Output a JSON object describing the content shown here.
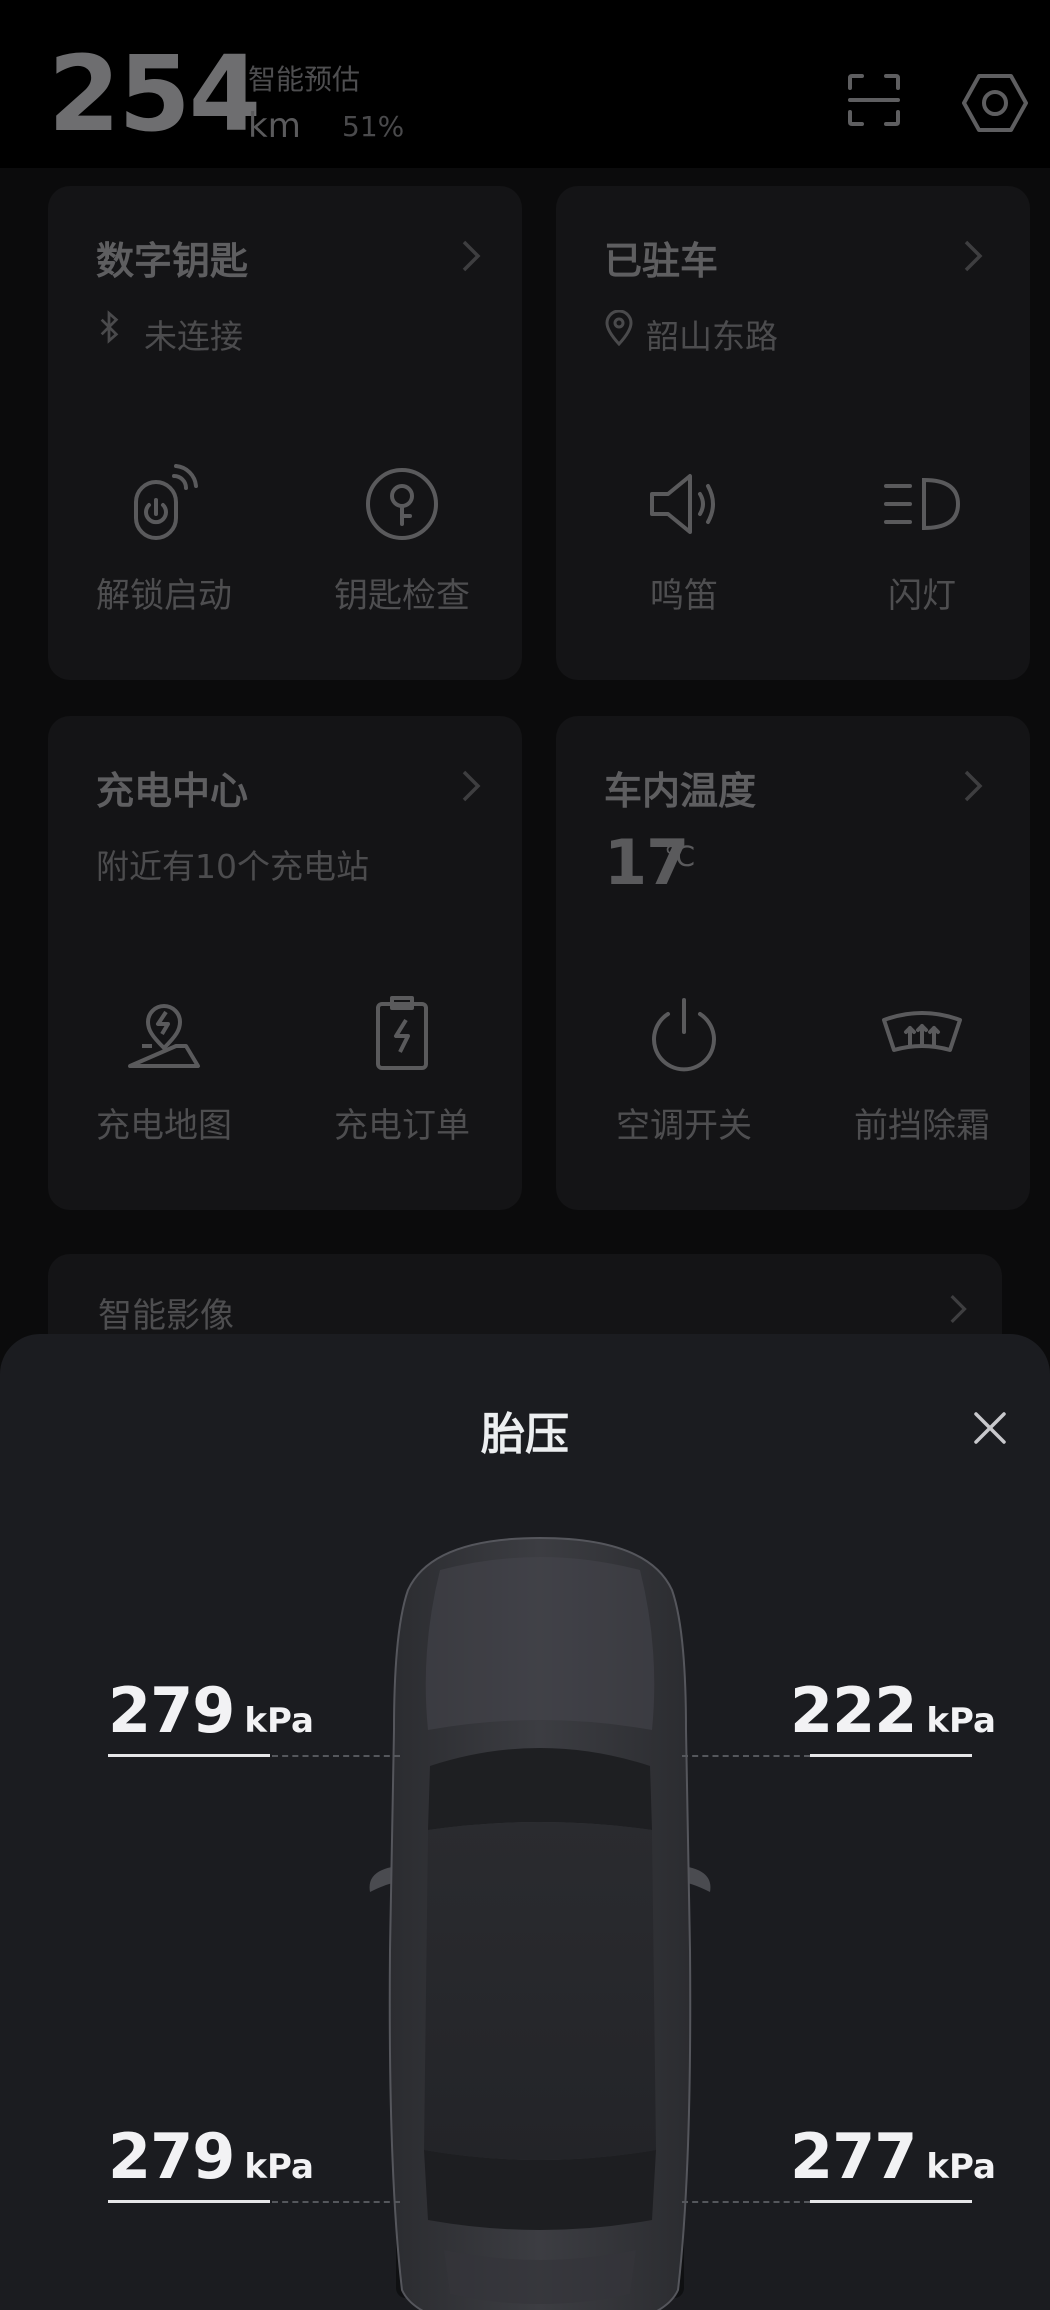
{
  "header": {
    "range_value": "254",
    "range_label": "智能预估",
    "range_unit": "km",
    "battery_percent": "51%",
    "icons": [
      "scan-icon",
      "gear-icon"
    ]
  },
  "cards": {
    "digital_key": {
      "title": "数字钥匙",
      "status": "未连接",
      "actions": [
        {
          "label": "解锁启动",
          "icon": "unlock-start-icon"
        },
        {
          "label": "钥匙检查",
          "icon": "key-check-icon"
        }
      ]
    },
    "parked": {
      "title": "已驻车",
      "location": "韶山东路",
      "actions": [
        {
          "label": "鸣笛",
          "icon": "horn-icon"
        },
        {
          "label": "闪灯",
          "icon": "headlight-icon"
        }
      ]
    },
    "charging": {
      "title": "充电中心",
      "subtitle": "附近有10个充电站",
      "actions": [
        {
          "label": "充电地图",
          "icon": "charge-map-icon"
        },
        {
          "label": "充电订单",
          "icon": "charge-order-icon"
        }
      ]
    },
    "cabin_temp": {
      "title": "车内温度",
      "value": "17",
      "unit": "℃",
      "actions": [
        {
          "label": "空调开关",
          "icon": "power-icon"
        },
        {
          "label": "前挡除霜",
          "icon": "defrost-icon"
        }
      ]
    },
    "smart_camera": {
      "title": "智能影像"
    }
  },
  "tire_sheet": {
    "title": "胎压",
    "unit": "kPa",
    "front_left": "279",
    "front_right": "222",
    "rear_left": "279",
    "rear_right": "277"
  },
  "colors": {
    "sheet_bg": "#1b1c20",
    "app_bg": "#0b0b0c",
    "text_primary": "#f2f2f4",
    "text_dimmed": "#4e4e50"
  }
}
